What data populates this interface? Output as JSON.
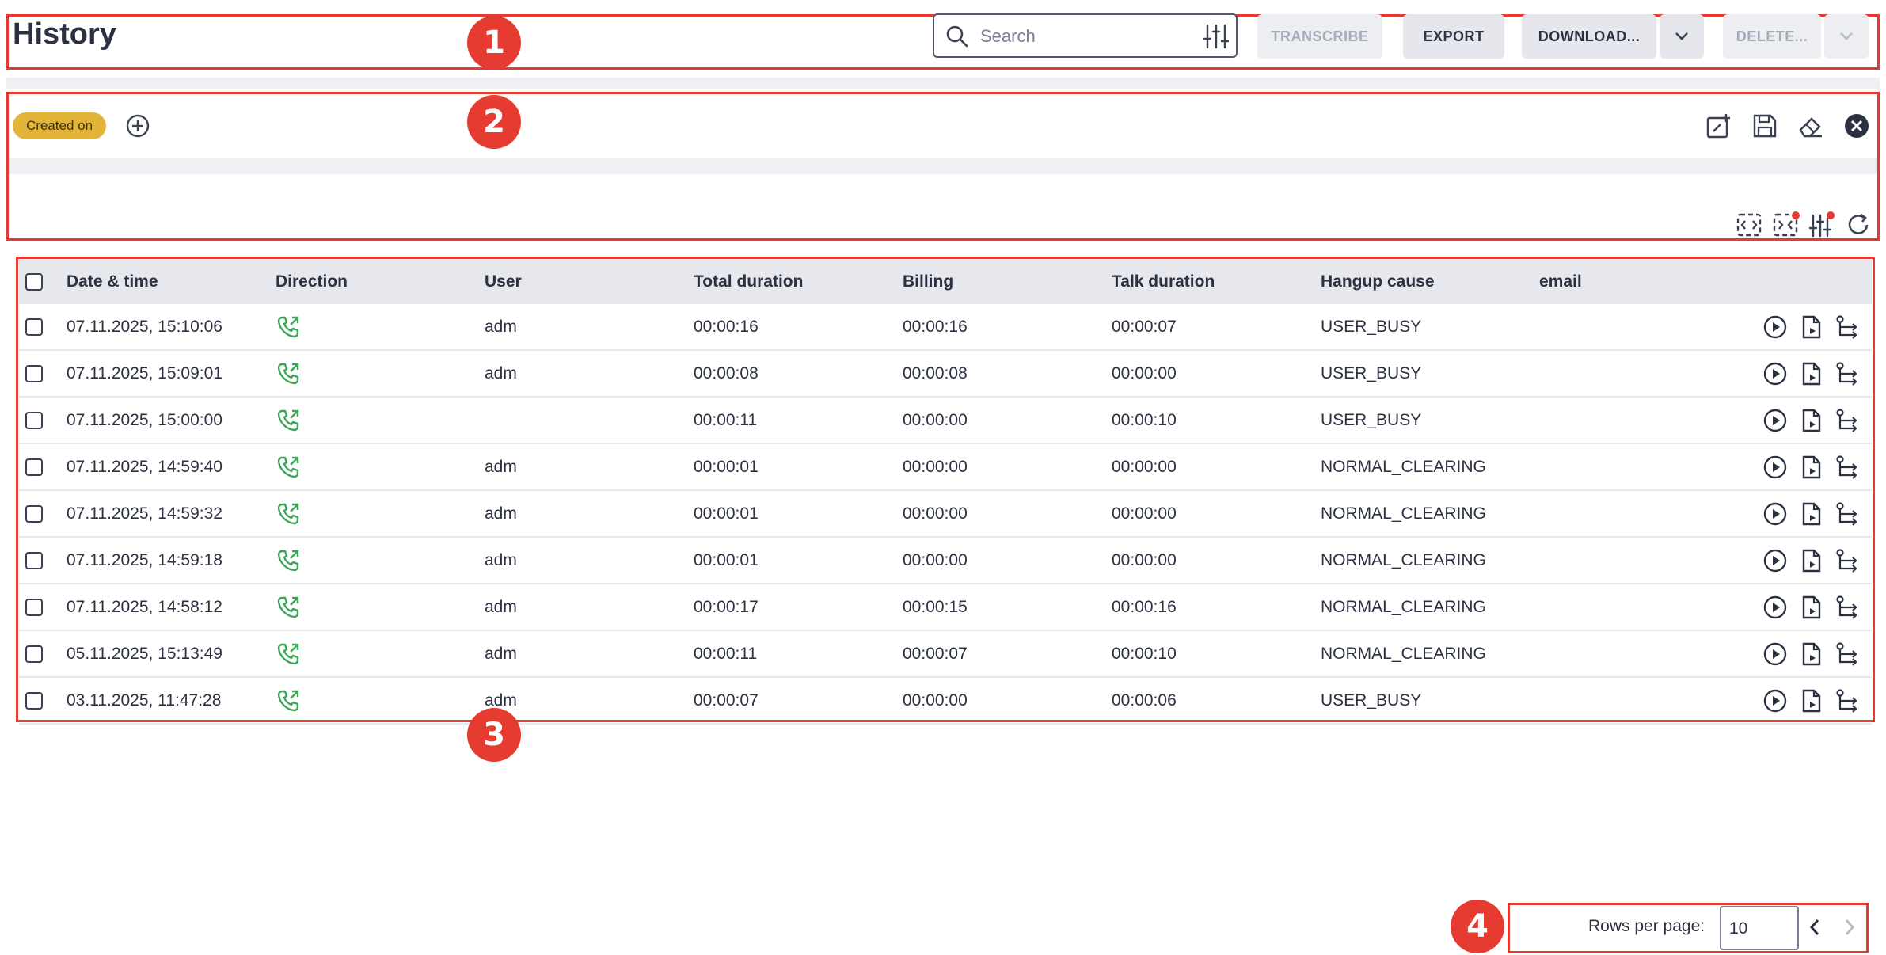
{
  "header": {
    "title": "History",
    "search_placeholder": "Search",
    "buttons": {
      "transcribe": "TRANSCRIBE",
      "export": "EXPORT",
      "download": "DOWNLOAD...",
      "delete": "DELETE..."
    }
  },
  "filters": {
    "chip_label": "Created on"
  },
  "annotations": [
    "1",
    "2",
    "3",
    "4"
  ],
  "table": {
    "columns": [
      "Date & time",
      "Direction",
      "User",
      "Total duration",
      "Billing",
      "Talk duration",
      "Hangup cause",
      "email"
    ],
    "rows": [
      {
        "datetime": "07.11.2025, 15:10:06",
        "user": "adm",
        "total": "00:00:16",
        "billing": "00:00:16",
        "talk": "00:00:07",
        "hangup": "USER_BUSY"
      },
      {
        "datetime": "07.11.2025, 15:09:01",
        "user": "adm",
        "total": "00:00:08",
        "billing": "00:00:08",
        "talk": "00:00:00",
        "hangup": "USER_BUSY"
      },
      {
        "datetime": "07.11.2025, 15:00:00",
        "user": "",
        "total": "00:00:11",
        "billing": "00:00:00",
        "talk": "00:00:10",
        "hangup": "USER_BUSY"
      },
      {
        "datetime": "07.11.2025, 14:59:40",
        "user": "adm",
        "total": "00:00:01",
        "billing": "00:00:00",
        "talk": "00:00:00",
        "hangup": "NORMAL_CLEARING"
      },
      {
        "datetime": "07.11.2025, 14:59:32",
        "user": "adm",
        "total": "00:00:01",
        "billing": "00:00:00",
        "talk": "00:00:00",
        "hangup": "NORMAL_CLEARING"
      },
      {
        "datetime": "07.11.2025, 14:59:18",
        "user": "adm",
        "total": "00:00:01",
        "billing": "00:00:00",
        "talk": "00:00:00",
        "hangup": "NORMAL_CLEARING"
      },
      {
        "datetime": "07.11.2025, 14:58:12",
        "user": "adm",
        "total": "00:00:17",
        "billing": "00:00:15",
        "talk": "00:00:16",
        "hangup": "NORMAL_CLEARING"
      },
      {
        "datetime": "05.11.2025, 15:13:49",
        "user": "adm",
        "total": "00:00:11",
        "billing": "00:00:07",
        "talk": "00:00:10",
        "hangup": "NORMAL_CLEARING"
      },
      {
        "datetime": "03.11.2025, 11:47:28",
        "user": "adm",
        "total": "00:00:07",
        "billing": "00:00:00",
        "talk": "00:00:06",
        "hangup": "USER_BUSY"
      }
    ]
  },
  "pagination": {
    "rows_per_page_label": "Rows per page:",
    "rows_per_page_value": "10"
  },
  "colors": {
    "annotation_red": "#e53b30",
    "direction_green": "#3aa655",
    "chip_yellow": "#e2b43a"
  }
}
